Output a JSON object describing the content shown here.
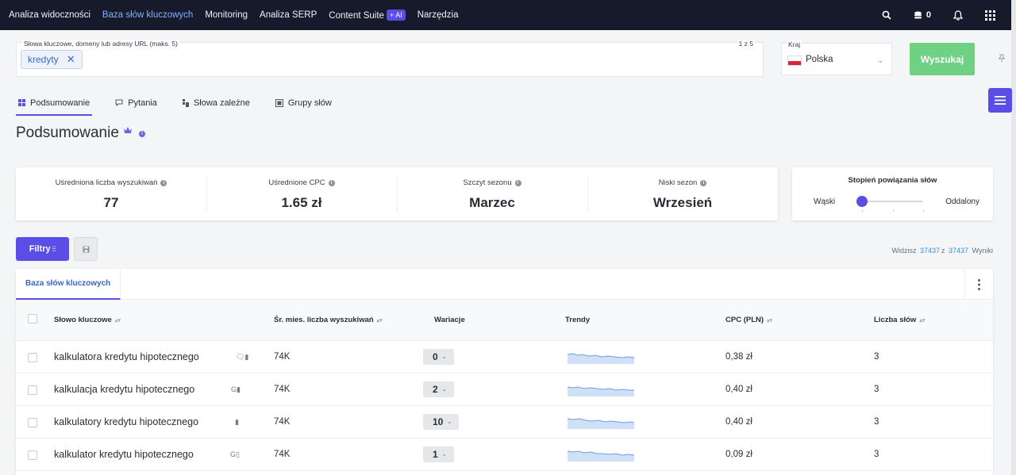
{
  "nav": {
    "items": [
      "Analiza widoczności",
      "Baza słów kluczowych",
      "Monitoring",
      "Analiza SERP",
      "Content Suite",
      "Narzędzia"
    ],
    "active_index": 1,
    "ai_badge": "+ AI",
    "credits": "0",
    "icons": [
      "search-icon",
      "credits-icon",
      "bell-icon",
      "apps-grid-icon"
    ]
  },
  "search": {
    "label": "Słowa kluczowe, domeny lub adresy URL (maks. 5)",
    "counter": "1 z 5",
    "chip": "kredyty",
    "country_label": "Kraj",
    "country_value": "Polska",
    "button": "Wyszukaj"
  },
  "subtabs": [
    "Podsumowanie",
    "Pytania",
    "Słowa zależne",
    "Grupy słów"
  ],
  "page_title": "Podsumowanie",
  "stats": [
    {
      "label": "Uśredniona liczba wyszukiwań",
      "value": "77"
    },
    {
      "label": "Uśrednione CPC",
      "value": "1.65 zł"
    },
    {
      "label": "Szczyt sezonu",
      "value": "Marzec"
    },
    {
      "label": "Niski sezon",
      "value": "Wrzesień"
    }
  ],
  "relation": {
    "title": "Stopień powiązania słów",
    "left": "Wąski",
    "right": "Oddalony",
    "level": 0
  },
  "filters": {
    "button": "Filtry",
    "results_prefix": "Widzisz",
    "shown": "37437",
    "sep": "z",
    "total": "37437",
    "results_suffix": "Wyniki"
  },
  "table": {
    "tab": "Baza słów kluczowych",
    "headers": [
      "Słowo kluczowe",
      "Śr. mies. liczba wyszukiwań",
      "Wariacje",
      "Trendy",
      "CPC (PLN)",
      "Liczba słów"
    ],
    "rows": [
      {
        "keyword": "kalkulatora kredytu hipotecznego",
        "features": "🗨▮",
        "volume": "74K",
        "variations": "0",
        "cpc": "0,38 zł",
        "words": "3"
      },
      {
        "keyword": "kalkulacja kredytu hipotecznego",
        "features": "G▮",
        "volume": "74K",
        "variations": "2",
        "cpc": "0,40 zł",
        "words": "3"
      },
      {
        "keyword": "kalkulatory kredytu hipotecznego",
        "features": "▮",
        "volume": "74K",
        "variations": "10",
        "cpc": "0,40 zł",
        "words": "3"
      },
      {
        "keyword": "kalkulator kredytu hipotecznego",
        "features": "G▯",
        "volume": "74K",
        "variations": "1",
        "cpc": "0,09 zł",
        "words": "3"
      }
    ]
  },
  "colors": {
    "nav_bg": "#171a2b",
    "accent": "#5b4ee6",
    "search_button": "#6ed183",
    "link": "#3c8fd6"
  }
}
